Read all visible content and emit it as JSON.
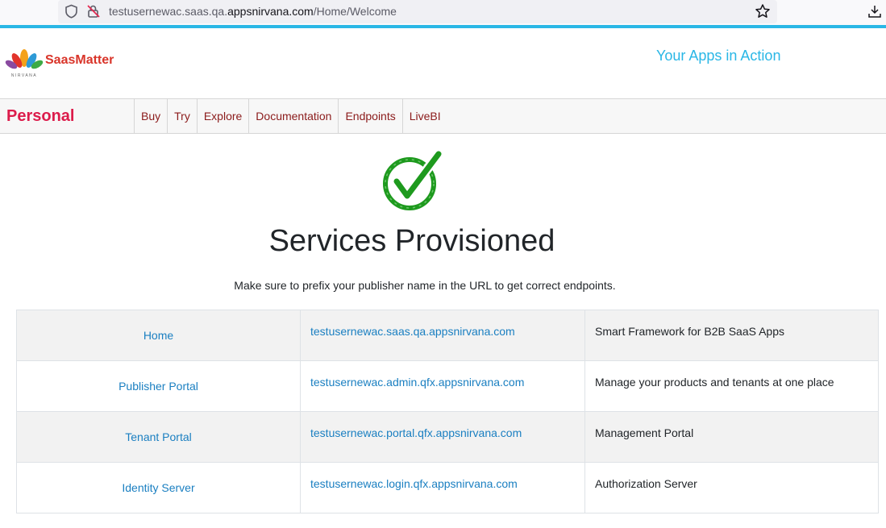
{
  "browser": {
    "url_prefix": "testusernewac.saas.qa.",
    "url_host": "appsnirvana.com",
    "url_path": "/Home/Welcome"
  },
  "header": {
    "logo_text": "SaasMatter",
    "logo_subtext": "NIRVANA",
    "tagline": "Your Apps in Action"
  },
  "nav": {
    "brand": "Personal",
    "items": [
      {
        "label": "Buy"
      },
      {
        "label": "Try"
      },
      {
        "label": "Explore"
      },
      {
        "label": "Documentation"
      },
      {
        "label": "Endpoints"
      },
      {
        "label": "LiveBI"
      }
    ]
  },
  "main": {
    "title": "Services Provisioned",
    "subtitle": "Make sure to prefix your publisher name in the URL to get correct endpoints.",
    "services": [
      {
        "name": "Home",
        "url": "testusernewac.saas.qa.appsnirvana.com",
        "description": "Smart Framework for B2B SaaS Apps"
      },
      {
        "name": "Publisher Portal",
        "url": "testusernewac.admin.qfx.appsnirvana.com",
        "description": "Manage your products and tenants at one place"
      },
      {
        "name": "Tenant Portal",
        "url": "testusernewac.portal.qfx.appsnirvana.com",
        "description": "Management Portal"
      },
      {
        "name": "Identity Server",
        "url": "testusernewac.login.qfx.appsnirvana.com",
        "description": "Authorization Server"
      }
    ]
  },
  "colors": {
    "accent": "#2ab7e6",
    "brand": "#dc1c4b",
    "link": "#1a7fc1",
    "nav_text": "#8b1b1b",
    "success": "#1e9a1e"
  }
}
